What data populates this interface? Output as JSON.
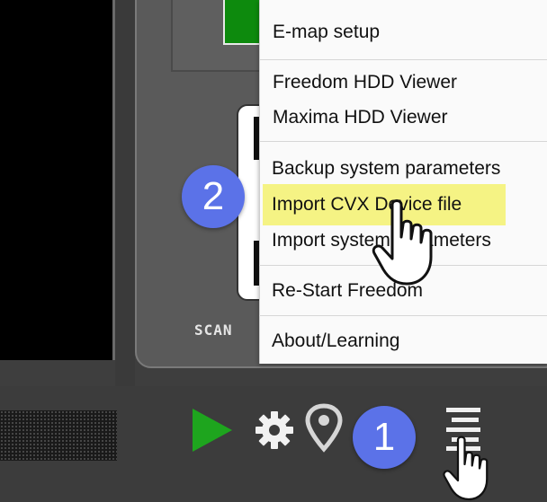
{
  "background_app": {
    "scan_label": "SCAN",
    "accent_green": "#0d8a0d",
    "play_color": "#1ea51e"
  },
  "toolbar": {
    "icons": [
      "play-icon",
      "gear-icon",
      "location-pin-icon",
      "hamburger-menu-icon"
    ]
  },
  "context_menu": {
    "items": [
      {
        "label": "E-map setup"
      },
      {
        "label": "Freedom HDD Viewer"
      },
      {
        "label": "Maxima HDD Viewer"
      },
      {
        "label": "Backup system parameters"
      },
      {
        "label": "Import CVX Device file"
      },
      {
        "label": "Import system parameters"
      },
      {
        "label": "Re-Start Freedom"
      },
      {
        "label": "About/Learning"
      }
    ],
    "highlight_color": "#f4f27a"
  },
  "annotations": {
    "step_badges": [
      {
        "label": "1"
      },
      {
        "label": "2"
      }
    ],
    "badge_color": "#5b72e8"
  }
}
